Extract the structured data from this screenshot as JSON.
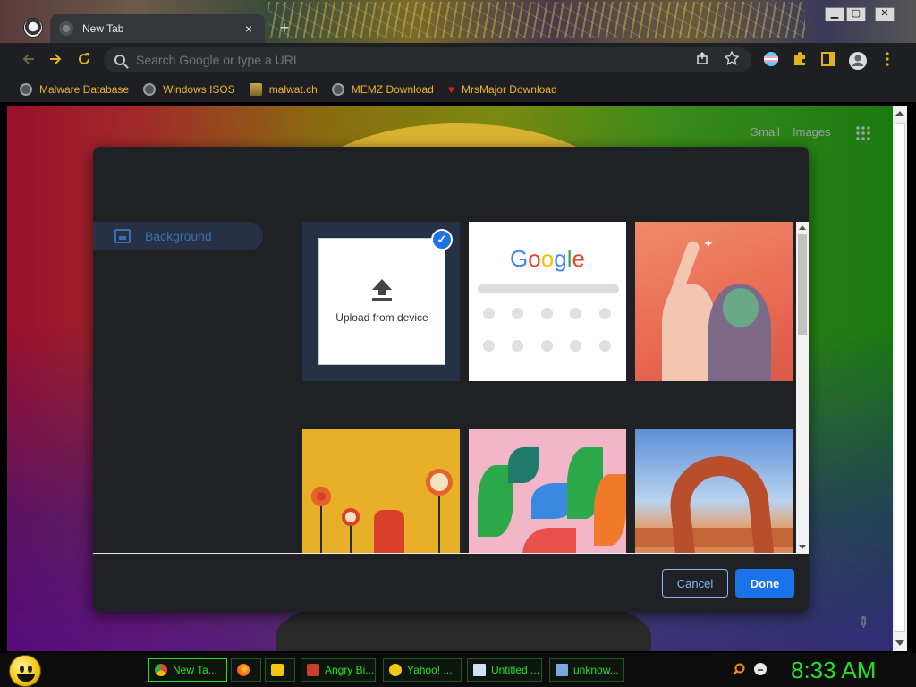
{
  "window": {
    "tab_title": "New Tab",
    "tab_close": "×",
    "new_tab": "+",
    "controls": {
      "minimize": "▁",
      "maximize": "▢",
      "close": "✕"
    }
  },
  "toolbar": {
    "back_icon": "arrow-left-icon",
    "forward_icon": "arrow-right-icon",
    "reload_icon": "reload-icon",
    "search_placeholder": "Search Google or type a URL",
    "share_icon": "share-icon",
    "bookmark_star_icon": "star-icon",
    "extension_icon": "puzzle-icon",
    "side_panel_icon": "side-panel-icon",
    "profile_icon": "avatar-icon",
    "menu_icon": "kebab-menu-icon"
  },
  "bookmarks": [
    {
      "label": "Malware Database",
      "icon": "globe-icon"
    },
    {
      "label": "Windows ISOS",
      "icon": "globe-icon"
    },
    {
      "label": "malwat.ch",
      "icon": "malwatch-icon"
    },
    {
      "label": "MEMZ Download",
      "icon": "globe-icon"
    },
    {
      "label": "MrsMajor Download",
      "icon": "heart-icon"
    }
  ],
  "ntp": {
    "gmail": "Gmail",
    "images": "Images"
  },
  "dialog": {
    "nav_item": "Background",
    "upload_label": "Upload from device",
    "google_tile_logo": [
      "G",
      "o",
      "o",
      "g",
      "l",
      "e"
    ],
    "cancel": "Cancel",
    "done": "Done"
  },
  "taskbar": {
    "items": [
      {
        "label": "New Ta...",
        "icon": "chrome-icon",
        "active": true
      },
      {
        "label": "",
        "icon": "firefox-icon",
        "active": false
      },
      {
        "label": "",
        "icon": "folder-icon",
        "active": false
      },
      {
        "label": "Angry Bi...",
        "icon": "angry-birds-icon",
        "active": false
      },
      {
        "label": "Yahoo! ...",
        "icon": "yahoo-messenger-icon",
        "active": false
      },
      {
        "label": "Untitled ...",
        "icon": "notepad-icon",
        "active": false
      },
      {
        "label": "unknow...",
        "icon": "window-icon",
        "active": false
      }
    ],
    "clock": "8:33 AM"
  },
  "colors": {
    "accent": "#1a73e8",
    "bookmark_text": "#f0b429",
    "taskbar_text": "#22e322"
  }
}
